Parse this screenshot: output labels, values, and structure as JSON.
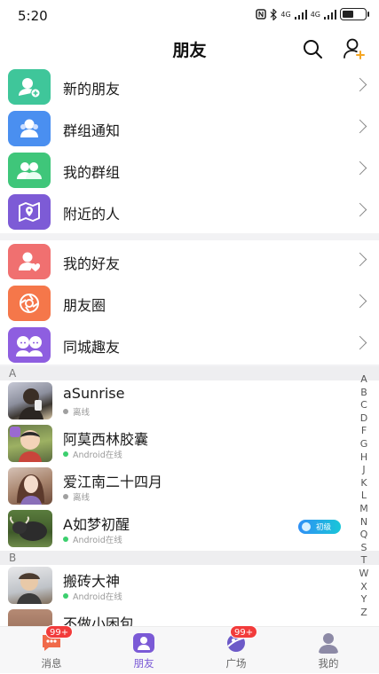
{
  "status_bar": {
    "time": "5:20",
    "signal_1": "4G",
    "signal_2": "4G"
  },
  "header": {
    "title": "朋友"
  },
  "menu_group_1": [
    {
      "label": "新的朋友",
      "icon": "new-friend-icon",
      "color": "#3fc69a"
    },
    {
      "label": "群组通知",
      "icon": "group-notice-icon",
      "color": "#4a8ff0"
    },
    {
      "label": "我的群组",
      "icon": "my-groups-icon",
      "color": "#3fc67a"
    },
    {
      "label": "附近的人",
      "icon": "nearby-icon",
      "color": "#7d5bd6"
    }
  ],
  "menu_group_2": [
    {
      "label": "我的好友",
      "icon": "my-friends-icon",
      "color": "#f07070"
    },
    {
      "label": "朋友圈",
      "icon": "moments-icon",
      "color": "#f5774a"
    },
    {
      "label": "同城趣友",
      "icon": "same-city-icon",
      "color": "#8e5ee0"
    }
  ],
  "sections": [
    {
      "letter": "A",
      "contacts": [
        {
          "name": "aSunrise",
          "status": "离线",
          "online": false
        },
        {
          "name": "阿莫西林胶囊",
          "status": "Android在线",
          "online": true
        },
        {
          "name": "爱江南二十四月",
          "status": "离线",
          "online": false
        },
        {
          "name": "A如梦初醒",
          "status": "Android在线",
          "online": true,
          "badge": "初级"
        }
      ]
    },
    {
      "letter": "B",
      "contacts": [
        {
          "name": "搬砖大神",
          "status": "Android在线",
          "online": true
        },
        {
          "name": "不做小困包",
          "status": "",
          "online": false
        }
      ]
    }
  ],
  "index_letters": [
    "A",
    "B",
    "C",
    "D",
    "F",
    "G",
    "H",
    "J",
    "K",
    "L",
    "M",
    "N",
    "Q",
    "S",
    "T",
    "W",
    "X",
    "Y",
    "Z"
  ],
  "tabs": [
    {
      "label": "消息",
      "badge": "99+"
    },
    {
      "label": "朋友",
      "badge": ""
    },
    {
      "label": "广场",
      "badge": "99+"
    },
    {
      "label": "我的",
      "badge": ""
    }
  ],
  "colors": {
    "online": "#3ccf6e",
    "offline": "#a0a0a0",
    "accent": "#7b5ad6"
  }
}
